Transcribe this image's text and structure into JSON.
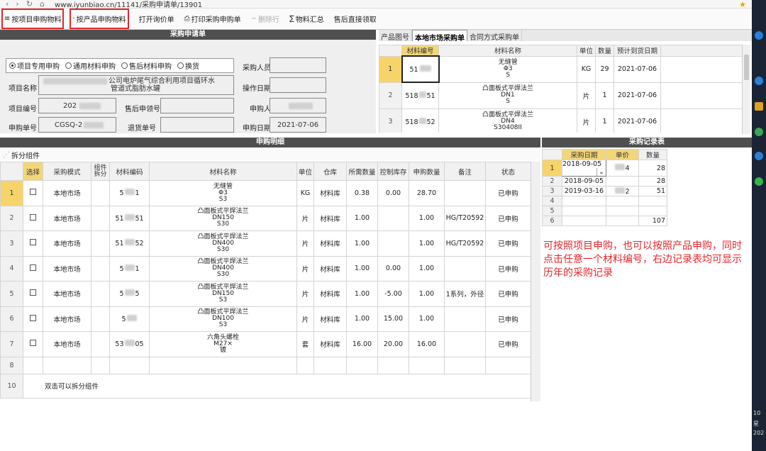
{
  "browser": {
    "url": "www.iyunbiao.cn/11141/采购申请单/13901"
  },
  "toolbar": {
    "by_project": "按项目申购物料",
    "by_product": "按产品申购物料",
    "open_inquiry": "打开询价单",
    "print_order": "打印采购申购单",
    "delete_row": "删除行",
    "summary": "物料汇总",
    "after_sale": "售后直接领取"
  },
  "form": {
    "header": "采购申请单",
    "radio_options": [
      "项目专用申购",
      "通用材料申购",
      "售后材料申购",
      "换货"
    ],
    "radio_selected": 0,
    "labels": {
      "buyer": "采购人员",
      "project_name": "项目名称",
      "op_date": "操作日期",
      "project_no": "项目编号",
      "after_sale_no": "售后申领号",
      "applicant": "申购人",
      "apply_no": "申购单号",
      "return_no": "退货单号",
      "apply_date": "申购日期"
    },
    "values": {
      "project_name": "公司电炉尾气综合利用项目循环水",
      "project_name_2": "管道式脂肪水罐",
      "project_no": "202",
      "apply_no": "CGSQ-2",
      "apply_date": "2021-07-06"
    }
  },
  "tabs": [
    "产品图号",
    "本地市场采购单",
    "合同方式采购单"
  ],
  "top_grid": {
    "columns": [
      "材料编号",
      "材料名称",
      "单位",
      "数量",
      "预计到货日期"
    ],
    "rows": [
      {
        "n": "1",
        "code": "51",
        "name": [
          "无缝管",
          "Φ3",
          "S"
        ],
        "unit": "KG",
        "qty": "29",
        "date": "2021-07-06"
      },
      {
        "n": "2",
        "code": "518",
        "code2": "51",
        "name": [
          "凸面板式平焊法兰",
          "DN1",
          "S"
        ],
        "unit": "片",
        "qty": "1",
        "date": "2021-07-06"
      },
      {
        "n": "3",
        "code": "518",
        "code2": "52",
        "name": [
          "凸面板式平焊法兰",
          "DN4",
          "S30408II"
        ],
        "unit": "片",
        "qty": "1",
        "date": "2021-07-06"
      }
    ]
  },
  "detail": {
    "header": "申购明细",
    "split": "拆分组件",
    "columns": [
      "选择",
      "采购模式",
      "组件拆分",
      "材料编码",
      "材料名称",
      "单位",
      "仓库",
      "所需数量",
      "控制库存",
      "申购数量",
      "备注",
      "状态"
    ],
    "rows": [
      {
        "n": "1",
        "mode": "本地市场",
        "code": "5",
        "code2": "1",
        "name": [
          "无缝管",
          "Φ3",
          "S3"
        ],
        "unit": "KG",
        "wh": "材料库",
        "need": "0.38",
        "ctrl": "0.00",
        "qty": "28.70",
        "remark": "",
        "status": "已申购"
      },
      {
        "n": "2",
        "mode": "本地市场",
        "code": "51",
        "code2": "51",
        "name": [
          "凸面板式平焊法兰",
          "DN150",
          "S30"
        ],
        "unit": "片",
        "wh": "材料库",
        "need": "1.00",
        "ctrl": "",
        "qty": "1.00",
        "remark": "HG/T20592",
        "status": "已申购"
      },
      {
        "n": "3",
        "mode": "本地市场",
        "code": "51",
        "code2": "52",
        "name": [
          "凸面板式平焊法兰",
          "DN400",
          "S30"
        ],
        "unit": "片",
        "wh": "材料库",
        "need": "1.00",
        "ctrl": "",
        "qty": "1.00",
        "remark": "HG/T20592",
        "status": "已申购"
      },
      {
        "n": "4",
        "mode": "本地市场",
        "code": "5",
        "code2": "1",
        "name": [
          "凸面板式平焊法兰",
          "DN400",
          "S30"
        ],
        "unit": "片",
        "wh": "材料库",
        "need": "1.00",
        "ctrl": "0.00",
        "qty": "1.00",
        "remark": "",
        "status": "已申购"
      },
      {
        "n": "5",
        "mode": "本地市场",
        "code": "5",
        "code2": "5",
        "name": [
          "凸面板式平焊法兰",
          "DN150",
          "S3"
        ],
        "unit": "片",
        "wh": "材料库",
        "need": "1.00",
        "ctrl": "-5.00",
        "qty": "1.00",
        "remark": "1系列，外径",
        "status": "已申购"
      },
      {
        "n": "6",
        "mode": "本地市场",
        "code": "5",
        "code2": "",
        "name": [
          "凸面板式平焊法兰",
          "DN100",
          "S3"
        ],
        "unit": "片",
        "wh": "材料库",
        "need": "1.00",
        "ctrl": "15.00",
        "qty": "1.00",
        "remark": "",
        "status": "已申购"
      },
      {
        "n": "7",
        "mode": "本地市场",
        "code": "53",
        "code2": "05",
        "name": [
          "六角头螺栓",
          "M27×",
          "镀"
        ],
        "unit": "套",
        "wh": "材料库",
        "need": "16.00",
        "ctrl": "20.00",
        "qty": "16.00",
        "remark": "",
        "status": "已申购"
      },
      {
        "n": "8"
      },
      {
        "n": "10",
        "hint": "双击可以拆分组件"
      }
    ]
  },
  "records": {
    "header": "采购记录表",
    "columns": [
      "采购日期",
      "单价",
      "数量"
    ],
    "rows": [
      {
        "n": "1",
        "date": "2018-09-05",
        "price": "4",
        "qty": "28"
      },
      {
        "n": "2",
        "date": "2018-09-05",
        "price": "",
        "qty": "28"
      },
      {
        "n": "3",
        "date": "2019-03-16",
        "price": "2",
        "qty": "51"
      },
      {
        "n": "4",
        "date": "",
        "price": "",
        "qty": ""
      },
      {
        "n": "5",
        "date": "",
        "price": "",
        "qty": ""
      },
      {
        "n": "6",
        "date": "",
        "price": "",
        "qty": "107"
      }
    ]
  },
  "note": "可按照项目申购，也可以按照产品申购，同时点击任意一个材料编号，右边记录表均可显示历年的采购记录",
  "sidebar": {
    "t1": "10",
    "t2": "星",
    "t3": "202"
  }
}
